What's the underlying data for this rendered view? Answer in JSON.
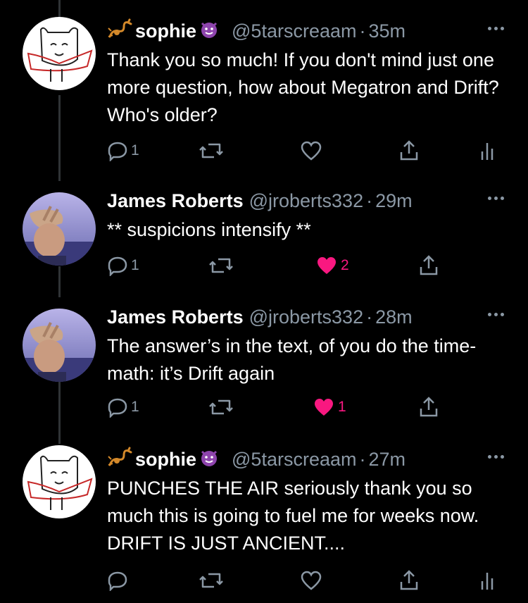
{
  "tweets": [
    {
      "author": "sophie",
      "handle": "@5tarscreaam",
      "time": "35m",
      "text": "Thank you so much! If you don't mind just one more question, how about Megatron and Drift? Who's older?",
      "reply_count": "1",
      "like_count": "",
      "liked": false,
      "avatar": "doodle-cat",
      "has_analytics": true
    },
    {
      "author": "James Roberts",
      "handle": "@jroberts332",
      "time": "29m",
      "text": "** suspicions intensify **",
      "reply_count": "1",
      "like_count": "2",
      "liked": true,
      "avatar": "photo-person",
      "has_analytics": false
    },
    {
      "author": "James Roberts",
      "handle": "@jroberts332",
      "time": "28m",
      "text": "The answer’s in the text, of you do the time-math: it’s Drift again",
      "reply_count": "1",
      "like_count": "1",
      "liked": true,
      "avatar": "photo-person",
      "has_analytics": false
    },
    {
      "author": "sophie",
      "handle": "@5tarscreaam",
      "time": "27m",
      "text": "PUNCHES THE AIR seriously thank you so much this is going to fuel me for weeks now. DRIFT IS JUST ANCIENT....",
      "reply_count": "",
      "like_count": "",
      "liked": false,
      "avatar": "doodle-cat",
      "has_analytics": true
    }
  ],
  "meta": {
    "separator": "·"
  },
  "colors": {
    "background": "#000000",
    "secondary_text": "#8b98a5",
    "like_pink": "#f91880",
    "emoji_purple": "#8e44ad"
  },
  "icons": [
    "scorpion-icon",
    "smiling-imp-icon",
    "reply-icon",
    "retweet-icon",
    "heart-icon",
    "share-icon",
    "analytics-icon",
    "more-icon"
  ]
}
